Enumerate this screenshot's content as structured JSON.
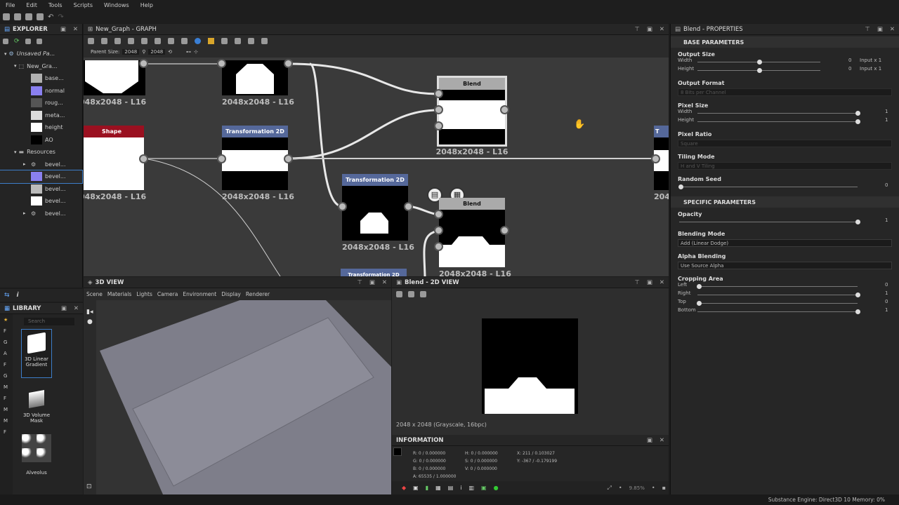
{
  "menu": [
    "File",
    "Edit",
    "Tools",
    "Scripts",
    "Windows",
    "Help"
  ],
  "explorer": {
    "title": "EXPLORER",
    "package": "Unsaved Pa...",
    "graph": "New_Gra...",
    "outputs": [
      {
        "label": "base...",
        "color": "#b0b0b0"
      },
      {
        "label": "normal",
        "color": "#8a80f0"
      },
      {
        "label": "roug...",
        "color": "#555555"
      },
      {
        "label": "meta...",
        "color": "#dcdcdc"
      },
      {
        "label": "height",
        "color": "#ffffff"
      },
      {
        "label": "AO",
        "color": "#000000"
      }
    ],
    "resources_label": "Resources",
    "resources": [
      "bevel...",
      "bevel...",
      "bevel...",
      "bevel...",
      "bevel..."
    ]
  },
  "graph": {
    "title": "New_Graph - GRAPH",
    "parent_size_label": "Parent Size:",
    "parent_size": "2048",
    "size2": "2048",
    "nodes": {
      "n1": {
        "label": "048x2048 - L16"
      },
      "n2": {
        "label": "2048x2048 - L16"
      },
      "blend1": {
        "title": "Blend",
        "label": "2048x2048 - L16"
      },
      "shape": {
        "title": "Shape",
        "label": "048x2048 - L16"
      },
      "tr1": {
        "title": "Transformation 2D",
        "label": "2048x2048 - L16"
      },
      "tr2": {
        "title": "Transformation 2D",
        "label": "2048x2048 - L16"
      },
      "blend2": {
        "title": "Blend",
        "label": "2048x2048 - L16"
      },
      "edge": {
        "title": "T",
        "label": "204"
      },
      "tr3": {
        "title": "Transformation 2D"
      }
    }
  },
  "view3d": {
    "title": "3D VIEW",
    "menu": [
      "Scene",
      "Materials",
      "Lights",
      "Camera",
      "Environment",
      "Display",
      "Renderer"
    ]
  },
  "view2d": {
    "title": "Blend - 2D VIEW",
    "zoom": "9.85%",
    "status": "2048 x 2048 (Grayscale, 16bpc)"
  },
  "info": {
    "title": "INFORMATION",
    "col1": [
      "R:    0   /  0.000000",
      "G:    0   /  0.000000",
      "B:    0   /  0.000000",
      "A: 65535 / 1.000000"
    ],
    "col2": [
      "H:    0  /  0.000000",
      "S:    0  /  0.000000",
      "V:    0  /  0.000000"
    ],
    "col3": [
      "X:  211  /  0.103027",
      "Y: -367  /  -0.179199"
    ]
  },
  "props": {
    "title": "Blend - PROPERTIES",
    "base": "BASE PARAMETERS",
    "output_size": "Output Size",
    "width": "Width",
    "height": "Height",
    "w_val": "0",
    "w_right": "Input x 1",
    "h_val": "0",
    "h_right": "Input x 1",
    "output_format": "Output Format",
    "output_format_val": "8 Bits per Channel",
    "pixel_size": "Pixel Size",
    "ps_w": "1",
    "ps_h": "1",
    "pixel_ratio": "Pixel Ratio",
    "pixel_ratio_val": "Square",
    "tiling_mode": "Tiling Mode",
    "tiling_val": "H and V Tiling",
    "random_seed": "Random Seed",
    "seed_val": "0",
    "specific": "SPECIFIC PARAMETERS",
    "opacity": "Opacity",
    "opacity_val": "1",
    "blending_mode": "Blending Mode",
    "blending_val": "Add (Linear Dodge)",
    "alpha_blending": "Alpha Blending",
    "alpha_val": "Use Source Alpha",
    "cropping": "Cropping Area",
    "left": "Left",
    "left_val": "0",
    "right": "Right",
    "right_val": "1",
    "top": "Top",
    "top_val": "0",
    "bottom": "Bottom",
    "bottom_val": "1"
  },
  "library": {
    "title": "LIBRARY",
    "search": "Search",
    "items": [
      "3D Linear Gradient",
      "3D Volume Mask",
      "Alveolus"
    ]
  },
  "status": "Substance Engine: Direct3D 10  Memory: 0%"
}
